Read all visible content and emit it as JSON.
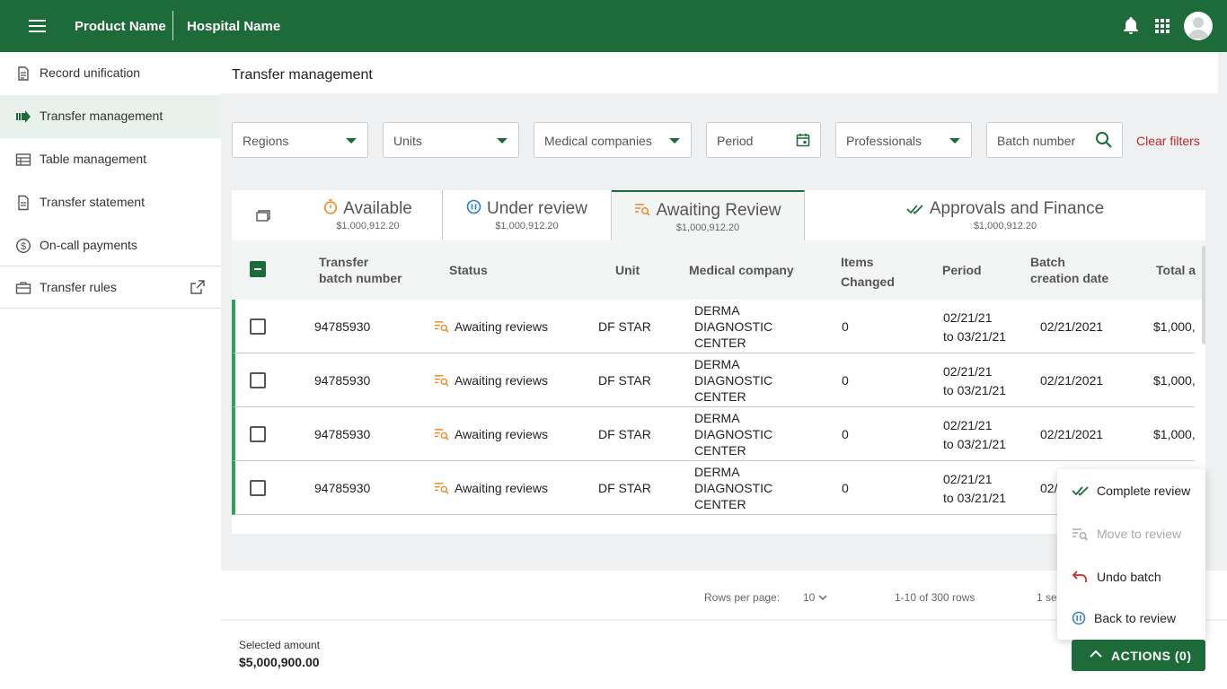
{
  "topbar": {
    "product_name": "Product Name",
    "hospital_name": "Hospital Name"
  },
  "sidebar": {
    "items": [
      {
        "label": "Record unification",
        "icon": "document-icon"
      },
      {
        "label": "Transfer management",
        "icon": "transfer-arrow-icon",
        "active": true
      },
      {
        "label": "Table management",
        "icon": "table-icon"
      },
      {
        "label": "Transfer statement",
        "icon": "statement-icon"
      },
      {
        "label": "On-call payments",
        "icon": "dollar-circle-icon"
      },
      {
        "label": "Transfer rules",
        "icon": "briefcase-icon",
        "external": true
      }
    ]
  },
  "page": {
    "title": "Transfer management"
  },
  "filters": {
    "regions": "Regions",
    "units": "Units",
    "medical_companies": "Medical companies",
    "period": "Period",
    "professionals": "Professionals",
    "batch_number": "Batch number",
    "clear": "Clear filters"
  },
  "tabs": [
    {
      "label": "Available",
      "amount": "$1,000,912.20"
    },
    {
      "label": "Under review",
      "amount": "$1,000,912.20"
    },
    {
      "label": "Awaiting Review",
      "amount": "$1,000,912.20"
    },
    {
      "label": "Approvals and Finance",
      "amount": "$1,000,912.20"
    }
  ],
  "table": {
    "headers": {
      "batch_l1": "Transfer",
      "batch_l2": "batch number",
      "status": "Status",
      "unit": "Unit",
      "company": "Medical company",
      "items_l1": "Items",
      "items_l2": "Changed",
      "period": "Period",
      "creation_l1": "Batch",
      "creation_l2": "creation date",
      "total": "Total a"
    },
    "rows": [
      {
        "batch": "94785930",
        "status": "Awaiting reviews",
        "unit": "DF STAR",
        "c1": "DERMA",
        "c2": "DIAGNOSTIC",
        "c3": "CENTER",
        "items": "0",
        "p1": "02/21/21",
        "p2": "to 03/21/21",
        "created": "02/21/2021",
        "total": "$1,000,"
      },
      {
        "batch": "94785930",
        "status": "Awaiting reviews",
        "unit": "DF STAR",
        "c1": "DERMA",
        "c2": "DIAGNOSTIC",
        "c3": "CENTER",
        "items": "0",
        "p1": "02/21/21",
        "p2": "to 03/21/21",
        "created": "02/21/2021",
        "total": "$1,000,"
      },
      {
        "batch": "94785930",
        "status": "Awaiting reviews",
        "unit": "DF STAR",
        "c1": "DERMA",
        "c2": "DIAGNOSTIC",
        "c3": "CENTER",
        "items": "0",
        "p1": "02/21/21",
        "p2": "to 03/21/21",
        "created": "02/21/2021",
        "total": "$1,000,"
      },
      {
        "batch": "94785930",
        "status": "Awaiting reviews",
        "unit": "DF STAR",
        "c1": "DERMA",
        "c2": "DIAGNOSTIC",
        "c3": "CENTER",
        "items": "0",
        "p1": "02/21/21",
        "p2": "to 03/21/21",
        "created": "02/",
        "total": ""
      }
    ]
  },
  "pager": {
    "rows_per_page_label": "Rows per page:",
    "rows_per_page_value": "10",
    "range": "1-10 of 300 rows",
    "selected": "1 sel"
  },
  "footer": {
    "selected_label": "Selected amount",
    "selected_value": "$5,000,900.00"
  },
  "actions_menu": {
    "items": [
      {
        "label": "Complete review",
        "enabled": true
      },
      {
        "label": "Move to review",
        "enabled": false
      },
      {
        "label": "Undo batch",
        "enabled": true
      },
      {
        "label": "Back to review",
        "enabled": true
      }
    ]
  },
  "actions_button": {
    "label": "ACTIONS  (0)"
  },
  "colors": {
    "brand": "#1e6b3a",
    "accent_orange": "#f08a24",
    "accent_blue": "#2a7bd4",
    "danger": "#c62828"
  }
}
